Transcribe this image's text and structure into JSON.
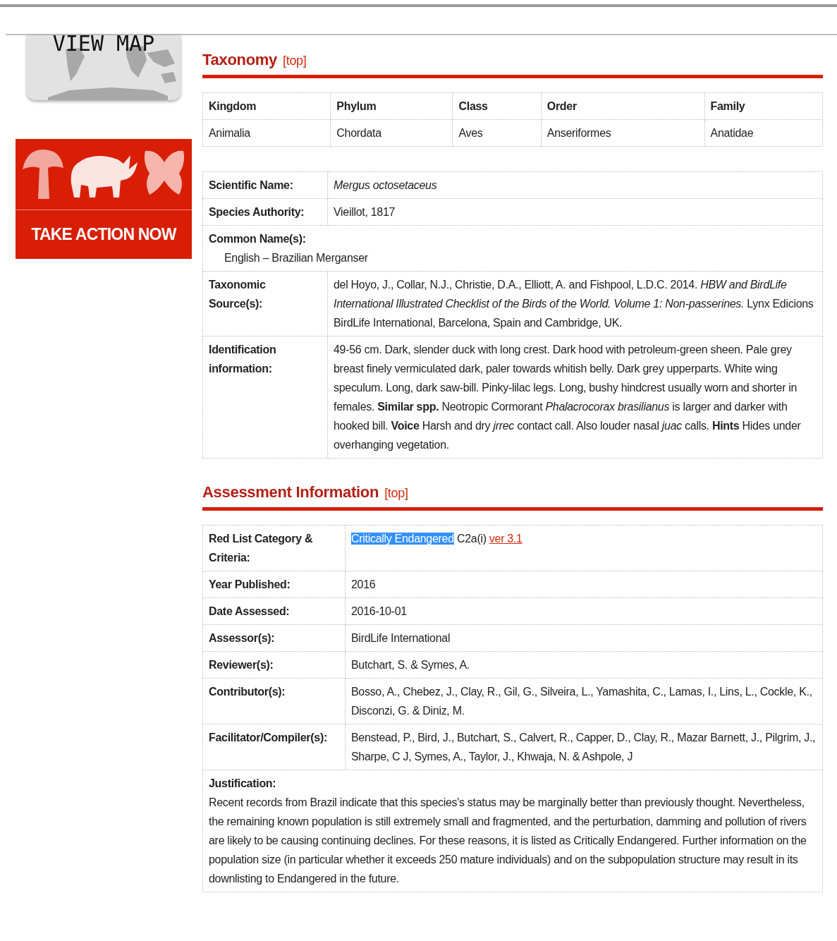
{
  "sidebar": {
    "map_label": "VIEW MAP",
    "banner_label": "TAKE ACTION NOW"
  },
  "taxonomy": {
    "title": "Taxonomy",
    "top_link": "[top]",
    "columns": [
      "Kingdom",
      "Phylum",
      "Class",
      "Order",
      "Family"
    ],
    "values": [
      "Animalia",
      "Chordata",
      "Aves",
      "Anseriformes",
      "Anatidae"
    ]
  },
  "species": [
    {
      "kind": "name",
      "label": "Scientific Name:",
      "value": "Mergus octosetaceus"
    },
    {
      "kind": "pair",
      "label": "Species Authority:",
      "value": "Vieillot, 1817"
    },
    {
      "kind": "list",
      "label": "Common Name(s):",
      "items": [
        "English – Brazilian Merganser"
      ]
    },
    {
      "kind": "pair",
      "label": "Taxonomic Source(s):",
      "value": "del Hoyo, J., Collar, N.J., Christie, D.A., Elliott, A. and Fishpool, L.D.C. 2014. *HBW and BirdLife International Illustrated Checklist of the Birds of the World. Volume 1: Non-passerines.* Lynx Edicions BirdLife International, Barcelona, Spain and Cambridge, UK."
    },
    {
      "kind": "pair",
      "label": "Identification information:",
      "value": "49-56 cm. Dark, slender duck with long crest. Dark hood with petroleum-green sheen. Pale grey breast finely vermiculated dark, paler towards whitish belly. Dark grey upperparts. White wing speculum. Long, dark saw-bill. Pinky-lilac legs. Long, bushy hindcrest usually worn and shorter in females. **Similar spp.** Neotropic Cormorant *Phalacrocorax brasilianus* is larger and darker with hooked bill. **Voice** Harsh and dry *jrrec* contact call. Also louder nasal *juac* calls. **Hints** Hides under overhanging vegetation."
    }
  ],
  "assessment": {
    "title": "Assessment Information",
    "top_link": "[top]",
    "rows": [
      {
        "kind": "category",
        "label": "Red List Category & Criteria:",
        "category": "Critically Endangered",
        "highlighted": true,
        "criteria": "C2a(i)",
        "version": "ver 3.1"
      },
      {
        "kind": "pair",
        "label": "Year Published:",
        "value": "2016"
      },
      {
        "kind": "pair",
        "label": "Date Assessed:",
        "value": "2016-10-01"
      },
      {
        "kind": "pair",
        "label": "Assessor(s):",
        "value": "BirdLife International"
      },
      {
        "kind": "pair",
        "label": "Reviewer(s):",
        "value": "Butchart, S. & Symes, A."
      },
      {
        "kind": "pair",
        "label": "Contributor(s):",
        "value": "Bosso, A., Chebez, J., Clay, R., Gil, G., Silveira, L., Yamashita, C., Lamas, I., Lins, L., Cockle, K., Disconzi, G. & Diniz, M."
      },
      {
        "kind": "pair",
        "label": "Facilitator/Compiler(s):",
        "value": "Benstead, P., Bird, J., Butchart, S., Calvert, R., Capper, D., Clay, R., Mazar Barnett, J., Pilgrim, J., Sharpe, C J, Symes, A., Taylor, J., Khwaja, N. & Ashpole, J"
      },
      {
        "kind": "block",
        "label": "Justification:",
        "value": "Recent records from Brazil indicate that this species's status may be marginally better than previously thought. Nevertheless, the remaining known population is still extremely small and fragmented, and the perturbation, damming and pollution of rivers are likely to be causing continuing declines. For these reasons, it is listed as Critically Endangered. Further information on the population size (in particular whether it exceeds 250 mature individuals) and on the subpopulation structure may result in its downlisting to Endangered in the future."
      }
    ]
  }
}
